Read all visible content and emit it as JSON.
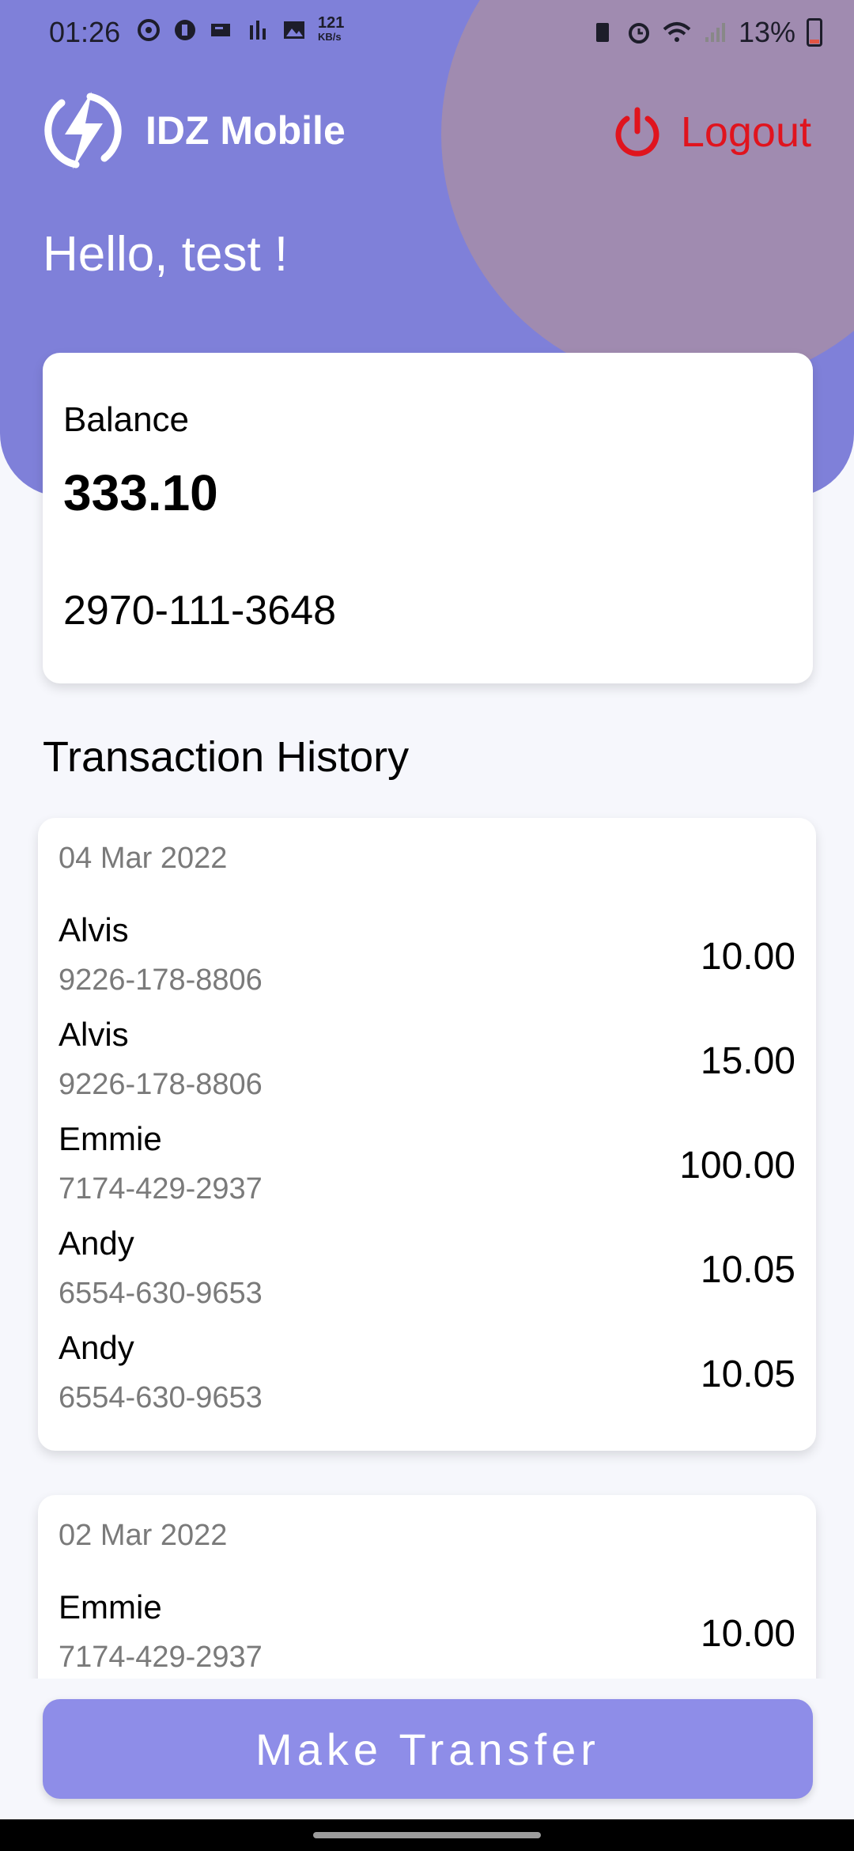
{
  "status_bar": {
    "time": "01:26",
    "network_speed": "121",
    "network_unit": "KB/s",
    "battery": "13%"
  },
  "header": {
    "app_name": "IDZ Mobile",
    "logout_label": "Logout",
    "greeting": "Hello, test !"
  },
  "balance": {
    "label": "Balance",
    "amount": "333.10",
    "account_number": "2970-111-3648"
  },
  "history": {
    "title": "Transaction History",
    "groups": [
      {
        "date": "04 Mar 2022",
        "transactions": [
          {
            "name": "Alvis",
            "account": "9226-178-8806",
            "amount": "10.00"
          },
          {
            "name": "Alvis",
            "account": "9226-178-8806",
            "amount": "15.00"
          },
          {
            "name": "Emmie",
            "account": "7174-429-2937",
            "amount": "100.00"
          },
          {
            "name": "Andy",
            "account": "6554-630-9653",
            "amount": "10.05"
          },
          {
            "name": "Andy",
            "account": "6554-630-9653",
            "amount": "10.05"
          }
        ]
      },
      {
        "date": "02 Mar 2022",
        "transactions": [
          {
            "name": "Emmie",
            "account": "7174-429-2937",
            "amount": "10.00"
          }
        ]
      }
    ]
  },
  "actions": {
    "transfer_label": "Make Transfer"
  },
  "colors": {
    "header": "#7f80d9",
    "header_circle": "#a08bb0",
    "logout": "#e0141e",
    "button": "#8e8de8"
  }
}
